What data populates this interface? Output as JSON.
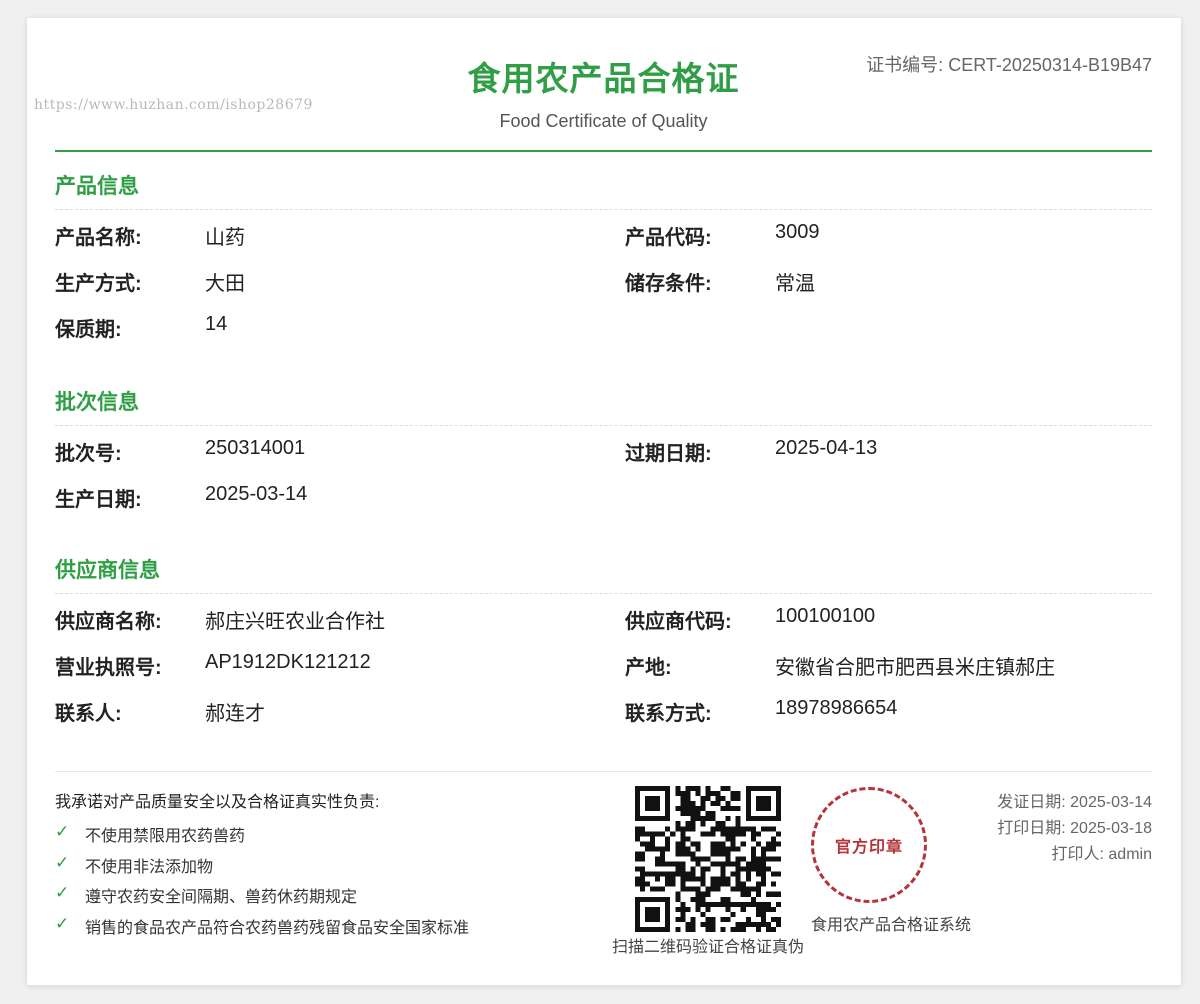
{
  "watermark": "https://www.huzhan.com/ishop28679",
  "header": {
    "title": "食用农产品合格证",
    "subtitle": "Food Certificate of Quality",
    "cert_no": "证书编号: CERT-20250314-B19B47"
  },
  "product": {
    "section_title": "产品信息",
    "name_label": "产品名称:",
    "name": "山药",
    "code_label": "产品代码:",
    "code": "3009",
    "method_label": "生产方式:",
    "method": "大田",
    "storage_label": "储存条件:",
    "storage": "常温",
    "shelf_label": "保质期:",
    "shelf": "14"
  },
  "batch": {
    "section_title": "批次信息",
    "no_label": "批次号:",
    "no": "250314001",
    "expire_label": "过期日期:",
    "expire": "2025-04-13",
    "prod_date_label": "生产日期:",
    "prod_date": "2025-03-14"
  },
  "supplier": {
    "section_title": "供应商信息",
    "name_label": "供应商名称:",
    "name": "郝庄兴旺农业合作社",
    "code_label": "供应商代码:",
    "code": "100100100",
    "license_label": "营业执照号:",
    "license": "AP1912DK121212",
    "origin_label": "产地:",
    "origin": "安徽省合肥市肥西县米庄镇郝庄",
    "contact_label": "联系人:",
    "contact": "郝连才",
    "phone_label": "联系方式:",
    "phone": "18978986654"
  },
  "pledge": {
    "title": "我承诺对产品质量安全以及合格证真实性负责:",
    "check_icon": "✓",
    "items": [
      "不使用禁限用农药兽药",
      "不使用非法添加物",
      "遵守农药安全间隔期、兽药休药期规定",
      "销售的食品农产品符合农药兽药残留食品安全国家标准"
    ]
  },
  "qr": {
    "caption": "扫描二维码验证合格证真伪",
    "icon": "qr-code-icon"
  },
  "seal": {
    "text": "官方印章",
    "system_name": "食用农产品合格证系统",
    "color": "#b5343a"
  },
  "meta": {
    "issue_date": "发证日期: 2025-03-14",
    "print_date": "打印日期: 2025-03-18",
    "printer": "打印人: admin"
  },
  "colors": {
    "accent": "#2f9e44",
    "seal": "#b5343a"
  }
}
